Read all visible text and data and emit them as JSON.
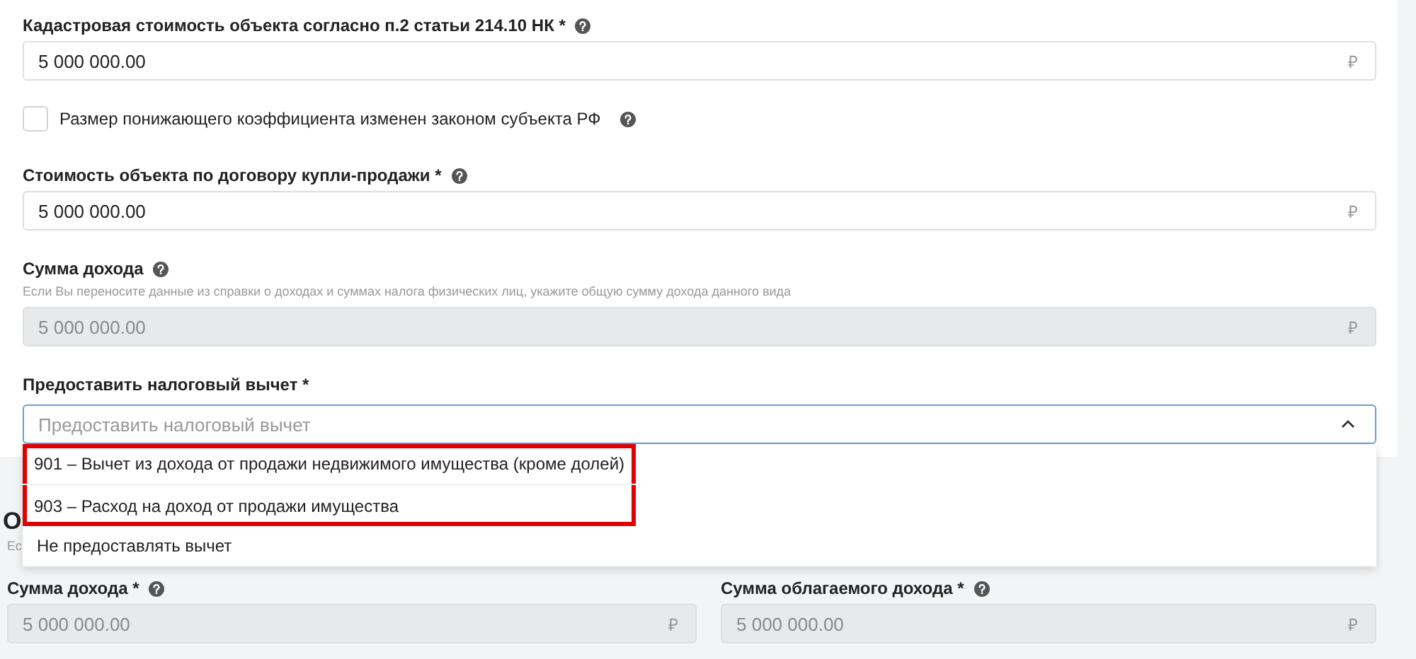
{
  "card": {
    "fields": [
      {
        "kind": "money",
        "label": "Кадастровая стоимость объекта согласно п.2 статьи 214.10 НК *",
        "help": true,
        "value": "5 000 000.00",
        "currency": "₽",
        "disabled": false
      },
      {
        "kind": "checkbox",
        "label": "Размер понижающего коэффициента изменен законом субъекта РФ",
        "help": true,
        "checked": false
      },
      {
        "kind": "money",
        "label": "Стоимость объекта по договору купли-продажи *",
        "help": true,
        "value": "5 000 000.00",
        "currency": "₽",
        "disabled": false
      },
      {
        "kind": "money",
        "label": "Сумма дохода",
        "help": true,
        "hint": "Если Вы переносите данные из справки о доходах и суммах налога физических лиц, укажите общую сумму дохода данного вида",
        "value": "5 000 000.00",
        "currency": "₽",
        "disabled": true
      },
      {
        "kind": "select",
        "label": "Предоставить налоговый вычет *",
        "placeholder": "Предоставить налоговый вычет",
        "expanded": true,
        "options": [
          {
            "label": "901 – Вычет из дохода от продажи недвижимого имущества (кроме долей)",
            "highlighted": true
          },
          {
            "label": "903 – Расход на доход от продажи имущества",
            "highlighted": true
          },
          {
            "label": "Не предоставлять вычет",
            "highlighted": false
          }
        ]
      }
    ]
  },
  "lower": {
    "heading": "О",
    "subtitle": "Ес",
    "fields": [
      {
        "kind": "money",
        "label": "Сумма дохода *",
        "help": true,
        "value": "5 000 000.00",
        "currency": "₽",
        "disabled": true
      },
      {
        "kind": "money",
        "label": "Сумма облагаемого дохода *",
        "help": true,
        "value": "5 000 000.00",
        "currency": "₽",
        "disabled": true
      }
    ]
  }
}
